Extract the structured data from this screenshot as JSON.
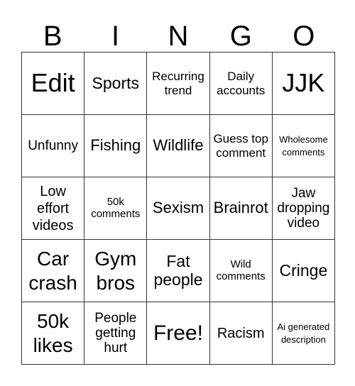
{
  "header": [
    "B",
    "I",
    "N",
    "G",
    "O"
  ],
  "cells": [
    [
      "Edit",
      "Sports",
      "Recurring trend",
      "Daily accounts",
      "JJK"
    ],
    [
      "Unfunny",
      "Fishing",
      "Wildlife",
      "Guess top comment",
      "Wholesome comments"
    ],
    [
      "Low effort videos",
      "50k comments",
      "Sexism",
      "Brainrot",
      "Jaw dropping video"
    ],
    [
      "Car crash",
      "Gym bros",
      "Fat people",
      "Wild comments",
      "Cringe"
    ],
    [
      "50k likes",
      "People getting hurt",
      "Free!",
      "Racism",
      "Ai generated description"
    ]
  ]
}
